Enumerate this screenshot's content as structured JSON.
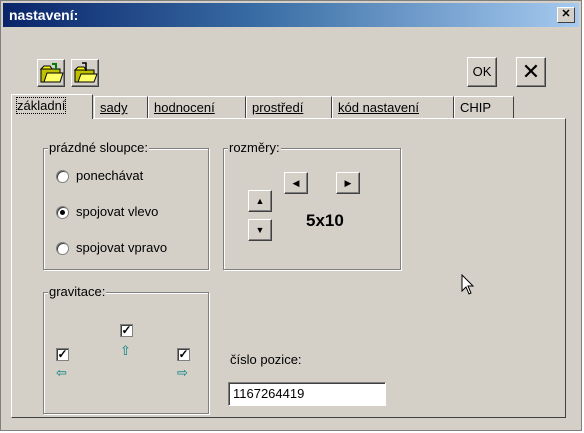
{
  "window": {
    "title": "nastavení:",
    "close_glyph": "✕"
  },
  "toolbar": {
    "open_icon": "folder-open-icon",
    "save_icon": "folder-save-icon",
    "ok_label": "OK",
    "cancel_glyph": "✕"
  },
  "tabs": [
    {
      "label": "základní",
      "active": true
    },
    {
      "label": "sady",
      "active": false
    },
    {
      "label": "hodnocení",
      "active": false
    },
    {
      "label": "prostředí",
      "active": false
    },
    {
      "label": "kód nastavení",
      "active": false
    },
    {
      "label": "CHIP",
      "active": false
    }
  ],
  "empty_columns": {
    "label": "prázdné sloupce:",
    "options": [
      {
        "label": "ponechávat",
        "selected": false
      },
      {
        "label": "spojovat vlevo",
        "selected": true
      },
      {
        "label": "spojovat vpravo",
        "selected": false
      }
    ]
  },
  "dimensions": {
    "label": "rozměry:",
    "value": "5x10",
    "left_glyph": "◀",
    "right_glyph": "▶",
    "up_glyph": "▲",
    "down_glyph": "▼"
  },
  "gravity": {
    "label": "gravitace:",
    "top_checked": true,
    "left_checked": true,
    "right_checked": true,
    "up_arrow": "⇧",
    "left_arrow": "⇦",
    "right_arrow": "⇨",
    "check_glyph": "✓"
  },
  "position": {
    "label": "číslo pozice:",
    "value": "1167264419"
  }
}
